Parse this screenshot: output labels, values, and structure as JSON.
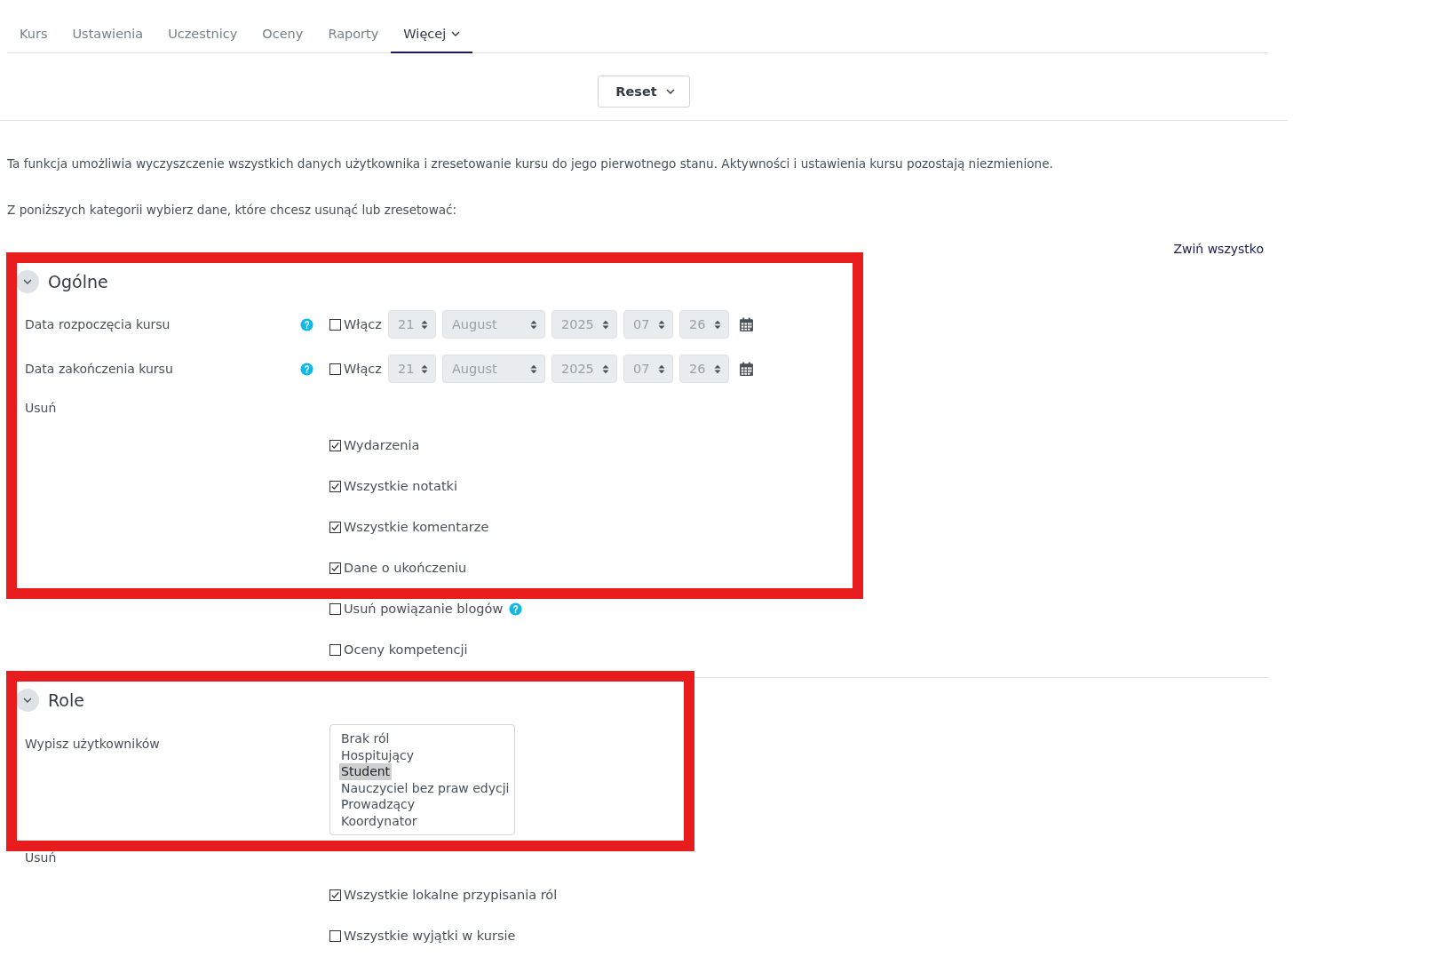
{
  "tabs": [
    {
      "label": "Kurs",
      "selected": false
    },
    {
      "label": "Ustawienia",
      "selected": false
    },
    {
      "label": "Uczestnicy",
      "selected": false
    },
    {
      "label": "Oceny",
      "selected": false
    },
    {
      "label": "Raporty",
      "selected": false
    },
    {
      "label": "Więcej",
      "selected": true,
      "dropdown": true
    }
  ],
  "action_menu": {
    "label": "Reset"
  },
  "intro": [
    "Ta funkcja umożliwia wyczyszczenie wszystkich danych użytkownika i zresetowanie kursu do jego pierwotnego stanu. Aktywności i ustawienia kursu pozostają niezmienione.",
    "Z poniższych kategorii wybierz dane, które chcesz usunąć lub zresetować:"
  ],
  "collapse_all": "Zwiń wszystko",
  "sections": [
    {
      "title": "Ogólne",
      "expanded": true,
      "highlighted": true,
      "rows": [
        {
          "kind": "date",
          "label": "Data rozpoczęcia kursu",
          "help": true,
          "highlighted": true,
          "enable": {
            "label": "Włącz",
            "checked": false
          },
          "fields": [
            "21",
            "August",
            "2025",
            "07",
            "26"
          ]
        },
        {
          "kind": "date",
          "label": "Data zakończenia kursu",
          "help": true,
          "highlighted": true,
          "enable": {
            "label": "Włącz",
            "checked": false
          },
          "fields": [
            "21",
            "August",
            "2025",
            "07",
            "26"
          ]
        },
        {
          "kind": "heading",
          "label": "Usuń",
          "highlighted": true
        },
        {
          "kind": "checkbox",
          "label": "Wydarzenia",
          "checked": true,
          "highlighted": true
        },
        {
          "kind": "checkbox",
          "label": "Wszystkie notatki",
          "checked": true,
          "highlighted": true
        },
        {
          "kind": "checkbox",
          "label": "Wszystkie komentarze",
          "checked": true,
          "highlighted": true
        },
        {
          "kind": "checkbox",
          "label": "Dane o ukończeniu",
          "checked": true,
          "highlighted": true
        },
        {
          "kind": "checkbox",
          "label": "Usuń powiązanie blogów",
          "checked": false,
          "help": true,
          "highlighted": false
        },
        {
          "kind": "checkbox",
          "label": "Oceny kompetencji",
          "checked": false,
          "highlighted": false
        }
      ]
    },
    {
      "title": "Role",
      "expanded": true,
      "highlighted": true,
      "rows": [
        {
          "kind": "listbox",
          "label": "Wypisz użytkowników",
          "highlighted": true,
          "options": [
            {
              "label": "Brak ról",
              "selected": false
            },
            {
              "label": "Hospitujący",
              "selected": false
            },
            {
              "label": "Student",
              "selected": true
            },
            {
              "label": "Nauczyciel bez praw edycji",
              "selected": false
            },
            {
              "label": "Prowadzący",
              "selected": false
            },
            {
              "label": "Koordynator",
              "selected": false
            }
          ]
        },
        {
          "kind": "heading",
          "label": "Usuń",
          "highlighted": false
        },
        {
          "kind": "checkbox",
          "label": "Wszystkie lokalne przypisania ról",
          "checked": true,
          "highlighted": false
        },
        {
          "kind": "checkbox",
          "label": "Wszystkie wyjątki w kursie",
          "checked": false,
          "highlighted": false
        }
      ]
    }
  ]
}
